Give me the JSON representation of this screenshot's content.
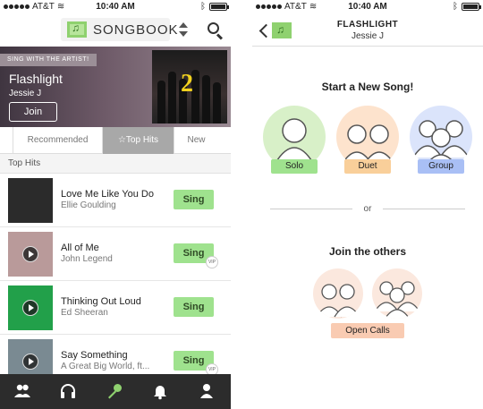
{
  "colors": {
    "accent_green": "#9fe28e",
    "solo_bg": "#d8f0c8",
    "duet_bg": "#fde3cd",
    "group_bg": "#dbe4fb",
    "duet_button": "#f9cf9a",
    "group_button": "#a9bff5",
    "open_calls_button": "#f9cbb2",
    "nav_bg": "#2c2c2c",
    "nav_active": "#8fd16f"
  },
  "left": {
    "status": {
      "carrier": "AT&T",
      "time": "10:40 AM"
    },
    "header": {
      "logo_text": "SONGBOOK",
      "logo_icon": "music-note-icon"
    },
    "banner": {
      "tag": "SING WITH THE ARTIST!",
      "title": "Flashlight",
      "artist": "Jessie J",
      "join_label": "Join",
      "album_number": "2"
    },
    "tabs": [
      {
        "label": "Recommended",
        "active": false
      },
      {
        "label": "☆Top Hits",
        "active": true
      },
      {
        "label": "New",
        "active": false
      }
    ],
    "section_title": "Top Hits",
    "songs": [
      {
        "title": "Love Me Like You Do",
        "artist": "Ellie Goulding",
        "sing_label": "Sing",
        "vip": false,
        "thumb_color": "#2b2b2b",
        "play": false
      },
      {
        "title": "All of Me",
        "artist": "John Legend",
        "sing_label": "Sing",
        "vip": true,
        "vip_label": "VIP",
        "thumb_color": "#b99a9a",
        "play": true
      },
      {
        "title": "Thinking Out Loud",
        "artist": "Ed Sheeran",
        "sing_label": "Sing",
        "vip": false,
        "thumb_color": "#22a04a",
        "play": true
      },
      {
        "title": "Say Something",
        "artist": "A Great Big World, ft...",
        "sing_label": "Sing",
        "vip": true,
        "vip_label": "VIP",
        "thumb_color": "#7a8a92",
        "play": true
      }
    ],
    "nav": [
      {
        "icon": "people-icon",
        "active": false
      },
      {
        "icon": "headphones-icon",
        "active": false
      },
      {
        "icon": "microphone-icon",
        "active": true
      },
      {
        "icon": "bell-icon",
        "active": false
      },
      {
        "icon": "person-icon",
        "active": false
      }
    ]
  },
  "right": {
    "status": {
      "carrier": "AT&T",
      "time": "10:40 AM"
    },
    "header": {
      "title": "FLASHLIGHT",
      "subtitle": "Jessie J"
    },
    "start_title": "Start a New Song!",
    "choices": [
      {
        "label": "Solo"
      },
      {
        "label": "Duet"
      },
      {
        "label": "Group"
      }
    ],
    "or_text": "or",
    "join_title": "Join the others",
    "open_calls_label": "Open Calls"
  }
}
